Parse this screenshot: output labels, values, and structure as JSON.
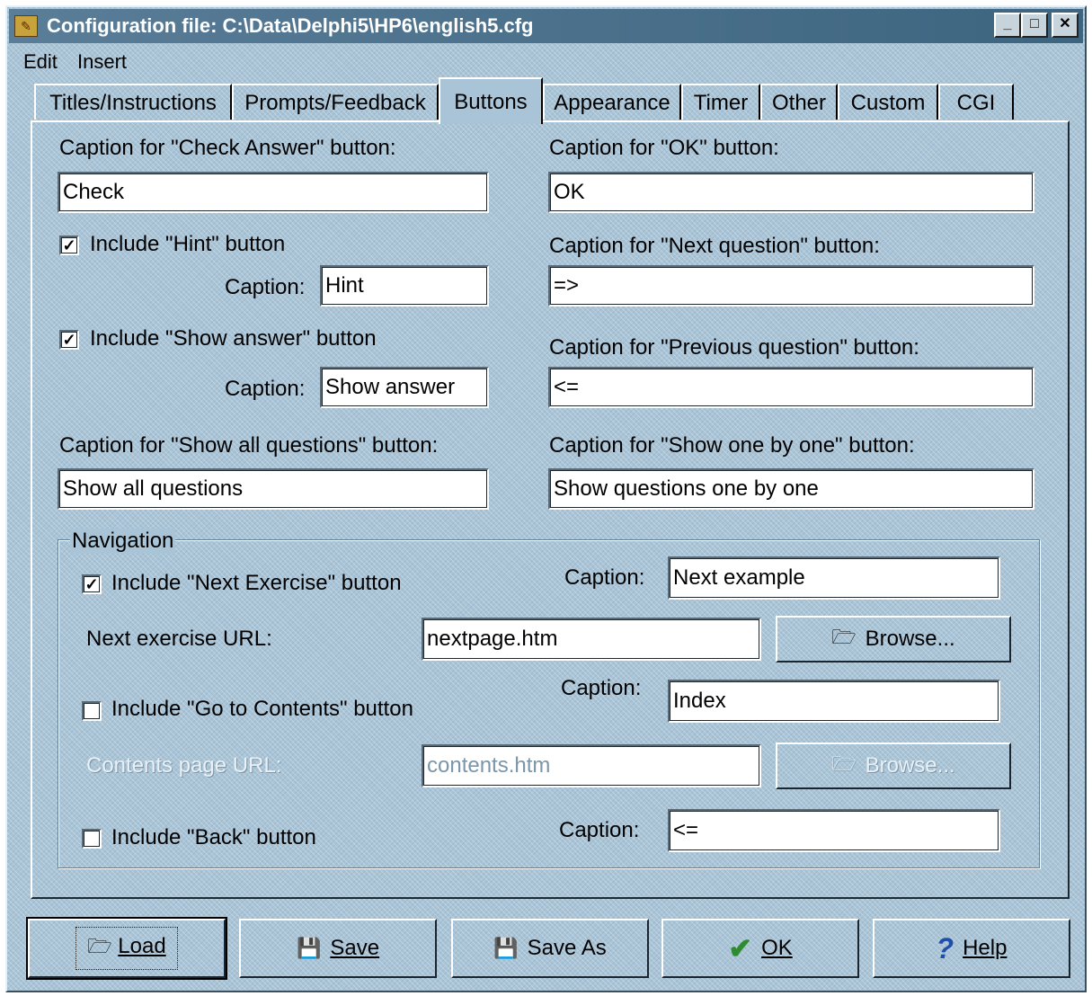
{
  "window": {
    "title": "Configuration file: C:\\Data\\Delphi5\\HP6\\english5.cfg",
    "controls": {
      "minimize": "_",
      "maximize": "□",
      "close": "✕"
    }
  },
  "menu": [
    {
      "label": "Edit"
    },
    {
      "label": "Insert"
    }
  ],
  "tabs": [
    {
      "label": "Titles/Instructions"
    },
    {
      "label": "Prompts/Feedback"
    },
    {
      "label": "Buttons",
      "active": true
    },
    {
      "label": "Appearance"
    },
    {
      "label": "Timer"
    },
    {
      "label": "Other"
    },
    {
      "label": "Custom"
    },
    {
      "label": "CGI"
    }
  ],
  "buttons_tab": {
    "check_answer": {
      "label": "Caption for \"Check Answer\" button:",
      "value": "Check"
    },
    "ok_caption": {
      "label": "Caption for \"OK\" button:",
      "value": "OK"
    },
    "hint": {
      "checkbox_label": "Include \"Hint\" button",
      "checked": true,
      "caption_label": "Caption:",
      "value": "Hint"
    },
    "next_question": {
      "label": "Caption for \"Next question\" button:",
      "value": "=>"
    },
    "show_answer": {
      "checkbox_label": "Include \"Show answer\" button",
      "checked": true,
      "caption_label": "Caption:",
      "value": "Show answer"
    },
    "previous_question": {
      "label": "Caption for \"Previous question\" button:",
      "value": "<="
    },
    "show_all": {
      "label": "Caption for \"Show all questions\" button:",
      "value": "Show all questions"
    },
    "show_one_by_one": {
      "label": "Caption for \"Show one by one\" button:",
      "value": "Show questions one by one"
    }
  },
  "navigation": {
    "legend": "Navigation",
    "next_exercise": {
      "checkbox_label": "Include \"Next Exercise\" button",
      "checked": true,
      "caption_label": "Caption:",
      "caption_value": "Next example",
      "url_label": "Next exercise URL:",
      "url_value": "nextpage.htm",
      "browse_label": "Browse..."
    },
    "contents": {
      "checkbox_label": "Include \"Go to Contents\" button",
      "checked": false,
      "caption_label": "Caption:",
      "caption_value": "Index",
      "url_label": "Contents page URL:",
      "url_value": "contents.htm",
      "browse_label": "Browse...",
      "disabled": true
    },
    "back": {
      "checkbox_label": "Include \"Back\" button",
      "checked": false,
      "caption_label": "Caption:",
      "caption_value": "<="
    }
  },
  "footer": {
    "load": "Load",
    "save": "Save",
    "save_as": "Save As",
    "ok": "OK",
    "help": "Help"
  }
}
